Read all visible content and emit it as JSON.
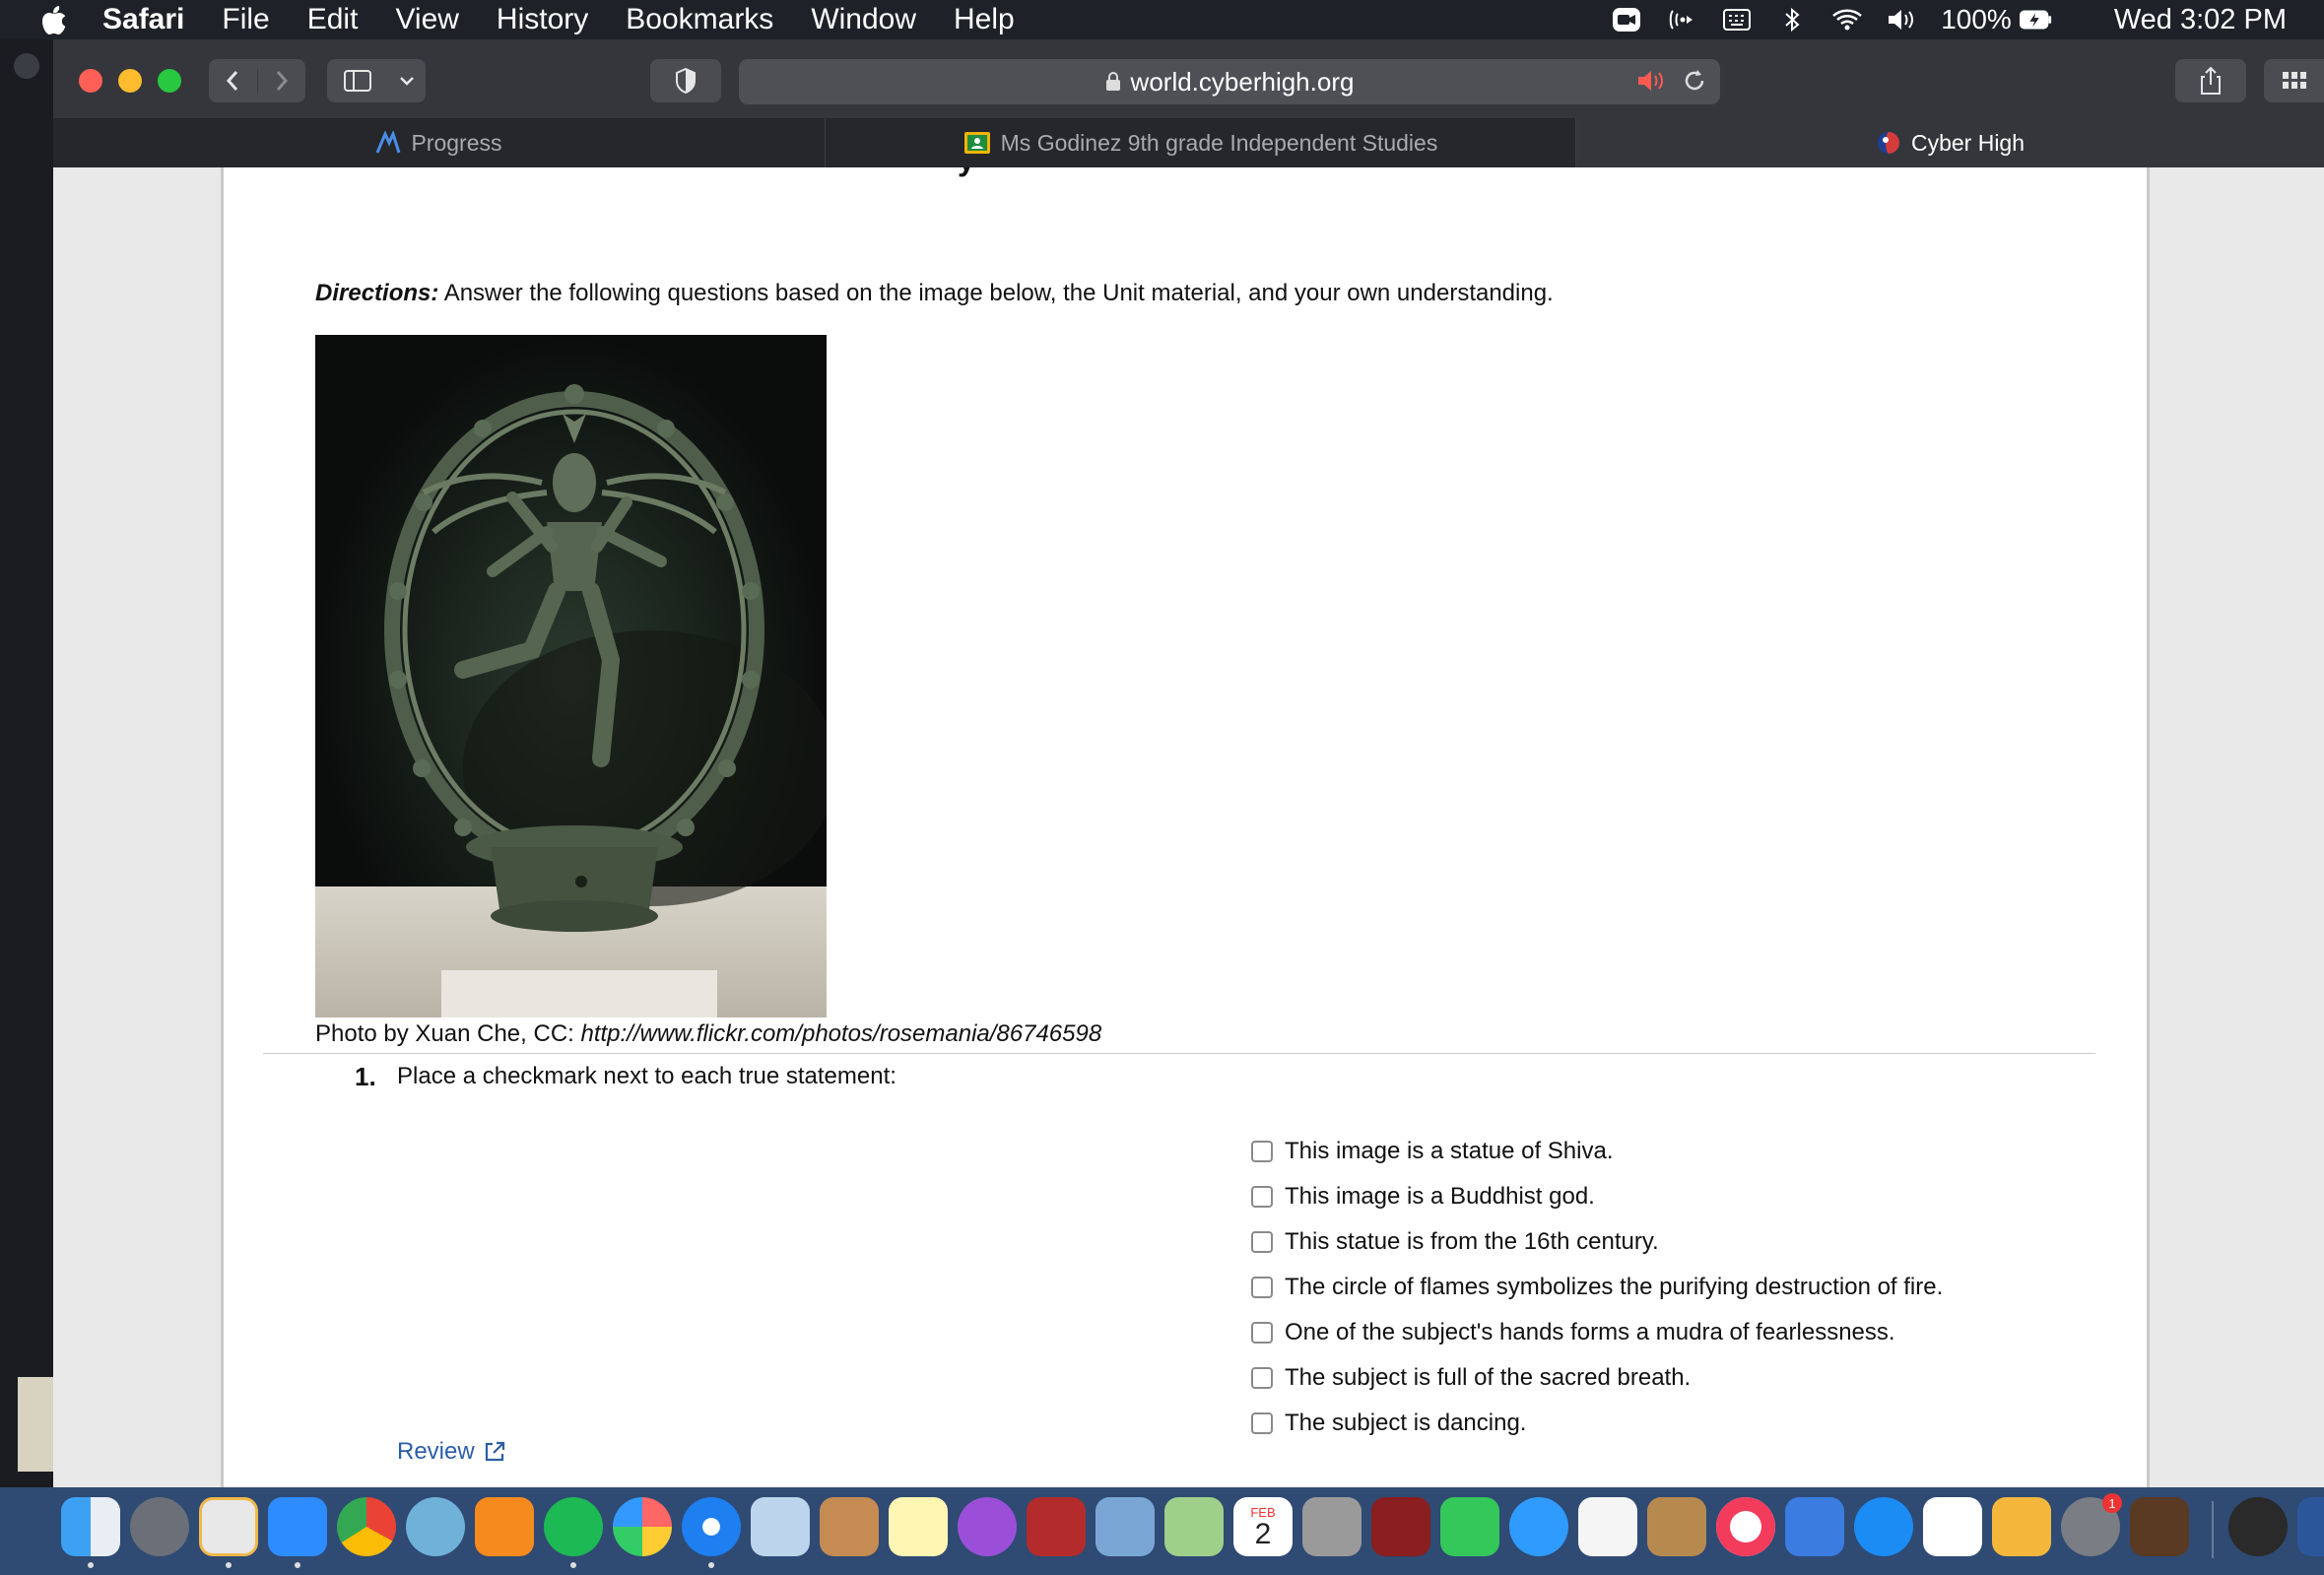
{
  "menubar": {
    "app_name": "Safari",
    "menus": [
      "File",
      "Edit",
      "View",
      "History",
      "Bookmarks",
      "Window",
      "Help"
    ],
    "battery": "100%",
    "clock": "Wed 3:02 PM"
  },
  "browser": {
    "url": "world.cyberhigh.org",
    "tabs": [
      {
        "label": "Progress",
        "icon": "progress-icon"
      },
      {
        "label": "Ms Godinez 9th grade Independent Studies",
        "icon": "classroom-icon"
      },
      {
        "label": "Cyber High",
        "icon": "cyberhigh-icon"
      }
    ],
    "active_tab": "Cyber High"
  },
  "page": {
    "directions_label": "Directions:",
    "directions_text": " Answer the following questions based on the image below, the Unit material, and your own understanding.",
    "photo": "bronze statue of dancing Shiva inside a ring of flames",
    "caption_prefix": "Photo by Xuan Che, CC: ",
    "caption_link": "http://www.flickr.com/photos/rosemania/86746598",
    "question_number": "1.",
    "question_text": "Place a checkmark next to each true statement:",
    "options": [
      "This image is a statue of Shiva.",
      "This image is a Buddhist god.",
      "This statue is from the 16th century.",
      "The circle of flames symbolizes the purifying destruction of fire.",
      "One of the subject's hands forms a mudra of fearlessness.",
      "The subject is full of the sacred breath.",
      "The subject is dancing."
    ],
    "review_label": "Review"
  },
  "dock": {
    "apps": [
      "Finder",
      "Launchpad",
      "Voice Memos",
      "Zoom",
      "Chrome",
      "Network Radar",
      "Books",
      "Spotify",
      "Photos",
      "Safari",
      "Preview",
      "Calculator",
      "Notes",
      "Podcasts",
      "Photo Booth",
      "Mail",
      "Maps",
      "Calendar",
      "Font Book",
      "Dictionary",
      "FaceTime",
      "Messages",
      "Reminders",
      "Contacts",
      "News",
      "Keynote",
      "App Store",
      "Music",
      "Pages",
      "System Preferences",
      "GarageBand"
    ],
    "calendar_day": "2",
    "calendar_month": "FEB",
    "system_prefs_badge": "1"
  }
}
